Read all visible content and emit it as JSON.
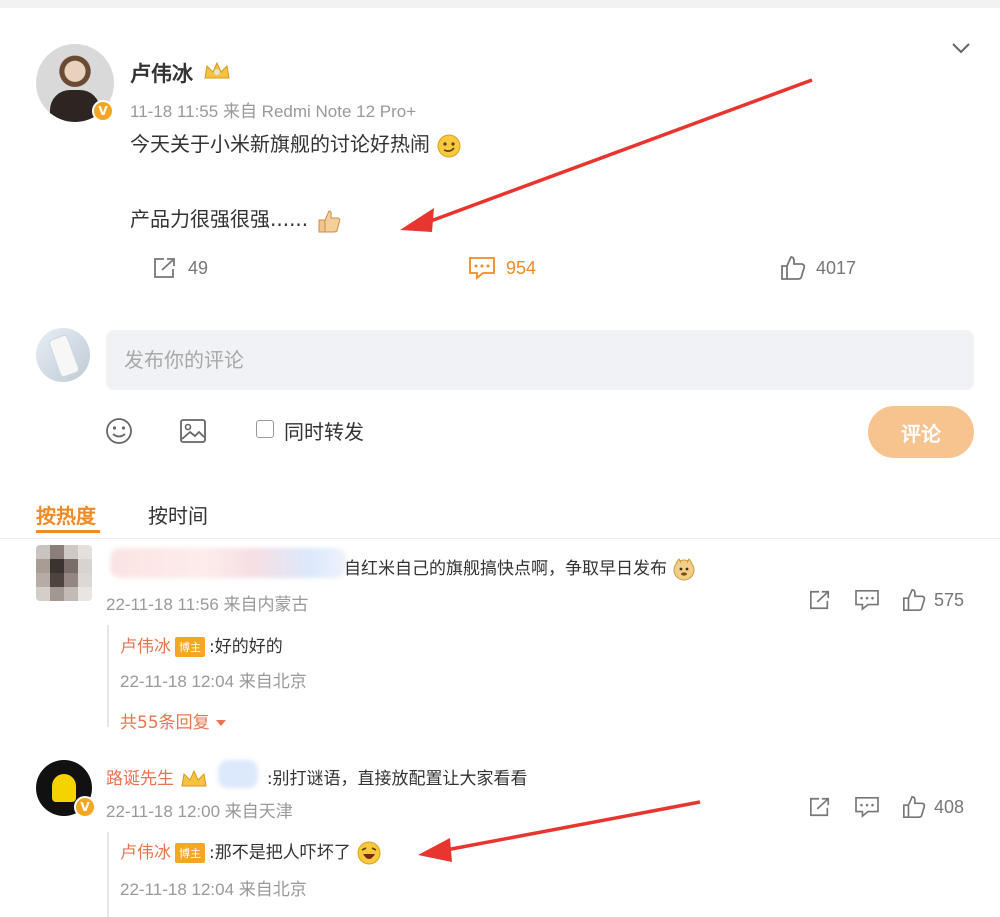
{
  "post": {
    "author": "卢伟冰",
    "meta": "11-18 11:55 来自 Redmi Note 12 Pro+",
    "line1": "今天关于小米新旗舰的讨论好热闹",
    "line2": "产品力很强很强......",
    "reposts": "49",
    "comments": "954",
    "likes": "4017"
  },
  "compose": {
    "placeholder": "发布你的评论",
    "repost_label": "同时转发",
    "submit_label": "评论"
  },
  "tabs": [
    "按热度",
    "按时间"
  ],
  "comments": [
    {
      "text": "自红米自己的旗舰搞快点啊，争取早日发布",
      "meta": "22-11-18 11:56 来自内蒙古",
      "likes": "575",
      "reply": {
        "author": "卢伟冰",
        "tag": "博主",
        "text": ":好的好的",
        "meta": "22-11-18 12:04 来自北京"
      },
      "more_replies": "共55条回复"
    },
    {
      "author": "路诞先生",
      "text": ":别打谜语，直接放配置让大家看看",
      "meta": "22-11-18 12:00 来自天津",
      "likes": "408",
      "reply": {
        "author": "卢伟冰",
        "tag": "博主",
        "text": ":那不是把人吓坏了",
        "meta": "22-11-18 12:04 来自北京"
      }
    }
  ],
  "colors": {
    "accent": "#f08a24",
    "name": "#eb7350",
    "submit_bg": "#f7c48f",
    "arrow": "#e8352f"
  },
  "icons": [
    "chevron-down-icon",
    "crown-icon",
    "repost-icon",
    "comment-icon",
    "like-icon",
    "emoji-icon",
    "image-icon",
    "verified-icon"
  ]
}
